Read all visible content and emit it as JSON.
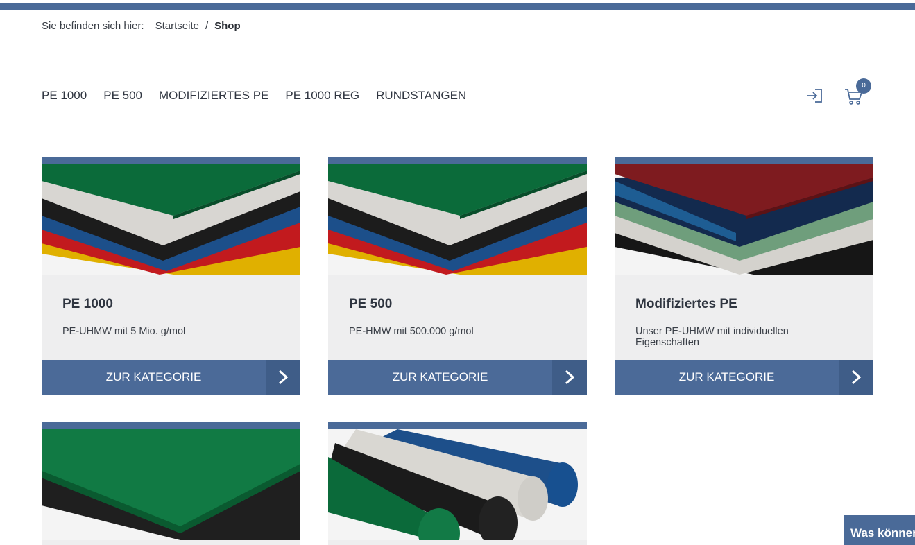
{
  "breadcrumb": {
    "label": "Sie befinden sich hier:",
    "home": "Startseite",
    "separator": "/",
    "current": "Shop"
  },
  "nav": {
    "items": [
      "PE 1000",
      "PE 500",
      "MODIFIZIERTES PE",
      "PE 1000 REG",
      "RUNDSTANGEN"
    ]
  },
  "header": {
    "login_icon": "login-icon",
    "cart_icon": "cart-icon",
    "cart_count": "0"
  },
  "cards": [
    {
      "title": "PE 1000",
      "desc": "PE-UHMW mit 5 Mio. g/mol",
      "button": "ZUR KATEGORIE"
    },
    {
      "title": "PE 500",
      "desc": "PE-HMW mit 500.000 g/mol",
      "button": "ZUR KATEGORIE"
    },
    {
      "title": "Modifiziertes PE",
      "desc": "Unser PE-UHMW mit individuellen Eigenschaften",
      "button": "ZUR KATEGORIE"
    }
  ],
  "chat": {
    "label": "Was können"
  },
  "colors": {
    "accent": "#4a6a98",
    "card_bg": "#eeeeef",
    "arrow_bg": "#3f5d88"
  }
}
